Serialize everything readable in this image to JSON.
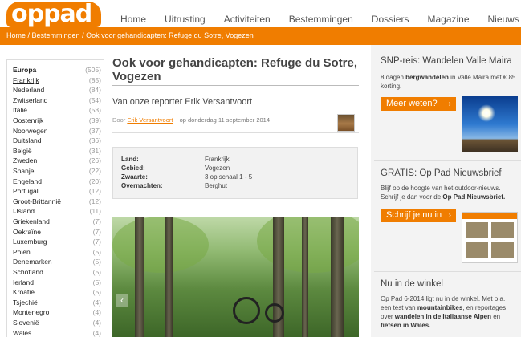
{
  "logo": {
    "text": "oppad"
  },
  "nav": [
    "Home",
    "Uitrusting",
    "Activiteiten",
    "Bestemmingen",
    "Dossiers",
    "Magazine",
    "Nieuws"
  ],
  "breadcrumb": {
    "home": "Home",
    "sep1": " / ",
    "section": "Bestemmingen",
    "sep2": " / ",
    "current": "Ook voor gehandicapten: Refuge du Sotre, Vogezen"
  },
  "sidebar": {
    "items": [
      {
        "name": "Europa",
        "count": "(505)"
      },
      {
        "name": "Frankrijk",
        "count": "(85)"
      },
      {
        "name": "Nederland",
        "count": "(84)"
      },
      {
        "name": "Zwitserland",
        "count": "(54)"
      },
      {
        "name": "Italië",
        "count": "(53)"
      },
      {
        "name": "Oostenrijk",
        "count": "(39)"
      },
      {
        "name": "Noorwegen",
        "count": "(37)"
      },
      {
        "name": "Duitsland",
        "count": "(36)"
      },
      {
        "name": "België",
        "count": "(31)"
      },
      {
        "name": "Zweden",
        "count": "(26)"
      },
      {
        "name": "Spanje",
        "count": "(22)"
      },
      {
        "name": "Engeland",
        "count": "(20)"
      },
      {
        "name": "Portugal",
        "count": "(12)"
      },
      {
        "name": "Groot-Brittannië",
        "count": "(12)"
      },
      {
        "name": "IJsland",
        "count": "(11)"
      },
      {
        "name": "Griekenland",
        "count": "(7)"
      },
      {
        "name": "Oekraïne",
        "count": "(7)"
      },
      {
        "name": "Luxemburg",
        "count": "(7)"
      },
      {
        "name": "Polen",
        "count": "(5)"
      },
      {
        "name": "Denemarken",
        "count": "(5)"
      },
      {
        "name": "Schotland",
        "count": "(5)"
      },
      {
        "name": "Ierland",
        "count": "(5)"
      },
      {
        "name": "Kroatië",
        "count": "(5)"
      },
      {
        "name": "Tsjechië",
        "count": "(4)"
      },
      {
        "name": "Montenegro",
        "count": "(4)"
      },
      {
        "name": "Slovenië",
        "count": "(4)"
      },
      {
        "name": "Wales",
        "count": "(4)"
      }
    ]
  },
  "article": {
    "title": "Ook voor gehandicapten: Refuge du Sotre, Vogezen",
    "subtitle": "Van onze reporter Erik Versantvoort",
    "byline_prefix": "Door",
    "author": "Erik Versantvoort",
    "date": "op donderdag 11 september 2014",
    "info": [
      {
        "key": "Land:",
        "value": "Frankrijk"
      },
      {
        "key": "Gebied:",
        "value": "Vogezen"
      },
      {
        "key": "Zwaarte:",
        "value": "3 op schaal 1 - 5"
      },
      {
        "key": "Overnachten:",
        "value": "Berghut"
      }
    ]
  },
  "right": {
    "snp": {
      "title": "SNP-reis: Wandelen Valle Maira",
      "text_a": "8 dagen ",
      "text_b": "bergwandelen",
      "text_c": " in Valle Maira met € 85 korting.",
      "button": "Meer weten?"
    },
    "gratis": {
      "title": "GRATIS: Op Pad Nieuwsbrief",
      "text_a": "Blijf op de hoogte van het outdoor-nieuws. Schrijf je dan voor de ",
      "text_b": "Op Pad Nieuwsbrief.",
      "button": "Schrijf je nu in"
    },
    "winkel": {
      "title": "Nu in de winkel",
      "text_a": "Op Pad 6-2014 ligt nu in de winkel. Met o.a. een test van ",
      "text_b": "mountainbikes",
      "text_c": ", en reportages over ",
      "text_d": "wandelen in de Italiaanse Alpen",
      "text_e": " en ",
      "text_f": "fietsen in Wales."
    }
  },
  "colors": {
    "accent": "#f07d00",
    "panel": "#f3f3f3"
  },
  "icons": {
    "button_chevron": "chevron-right-icon",
    "slider_arrow": "chevron-left-icon"
  }
}
